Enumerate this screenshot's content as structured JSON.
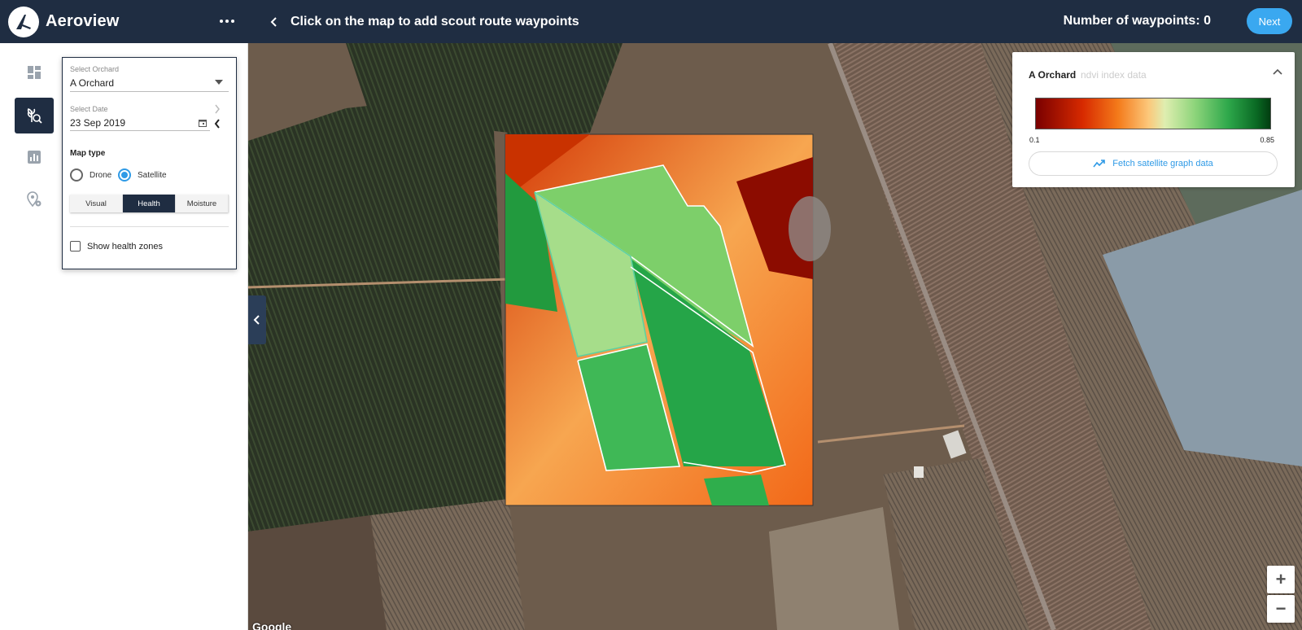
{
  "app": {
    "name": "Aeroview",
    "header_title": "Click on the map to add scout route waypoints",
    "waypoints_text": "Number of waypoints: 0",
    "next_label": "Next"
  },
  "sidebar": {
    "items": [
      {
        "icon": "dashboard-icon",
        "active": false
      },
      {
        "icon": "crop-scout-icon",
        "active": true
      },
      {
        "icon": "chart-icon",
        "active": false
      },
      {
        "icon": "location-settings-icon",
        "active": false
      }
    ]
  },
  "panel": {
    "orchard_label": "Select Orchard",
    "orchard_value": "A Orchard",
    "date_label": "Select Date",
    "date_value": "23 Sep 2019",
    "map_type_title": "Map type",
    "radio_options": [
      {
        "label": "Drone",
        "selected": false
      },
      {
        "label": "Satellite",
        "selected": true
      }
    ],
    "layers": [
      {
        "label": "Visual",
        "selected": false
      },
      {
        "label": "Health",
        "selected": true
      },
      {
        "label": "Moisture",
        "selected": false
      }
    ],
    "health_zones_label": "Show health zones",
    "health_zones_checked": false
  },
  "legend": {
    "orchard": "A Orchard",
    "subtitle": "ndvi index data",
    "min": "0.1",
    "max": "0.85",
    "fetch_label": "Fetch satellite graph data"
  },
  "map": {
    "attribution": "Google",
    "zoom_in": "+",
    "zoom_out": "−"
  },
  "colors": {
    "header": "#1f2d42",
    "accent": "#3aa8f0"
  }
}
